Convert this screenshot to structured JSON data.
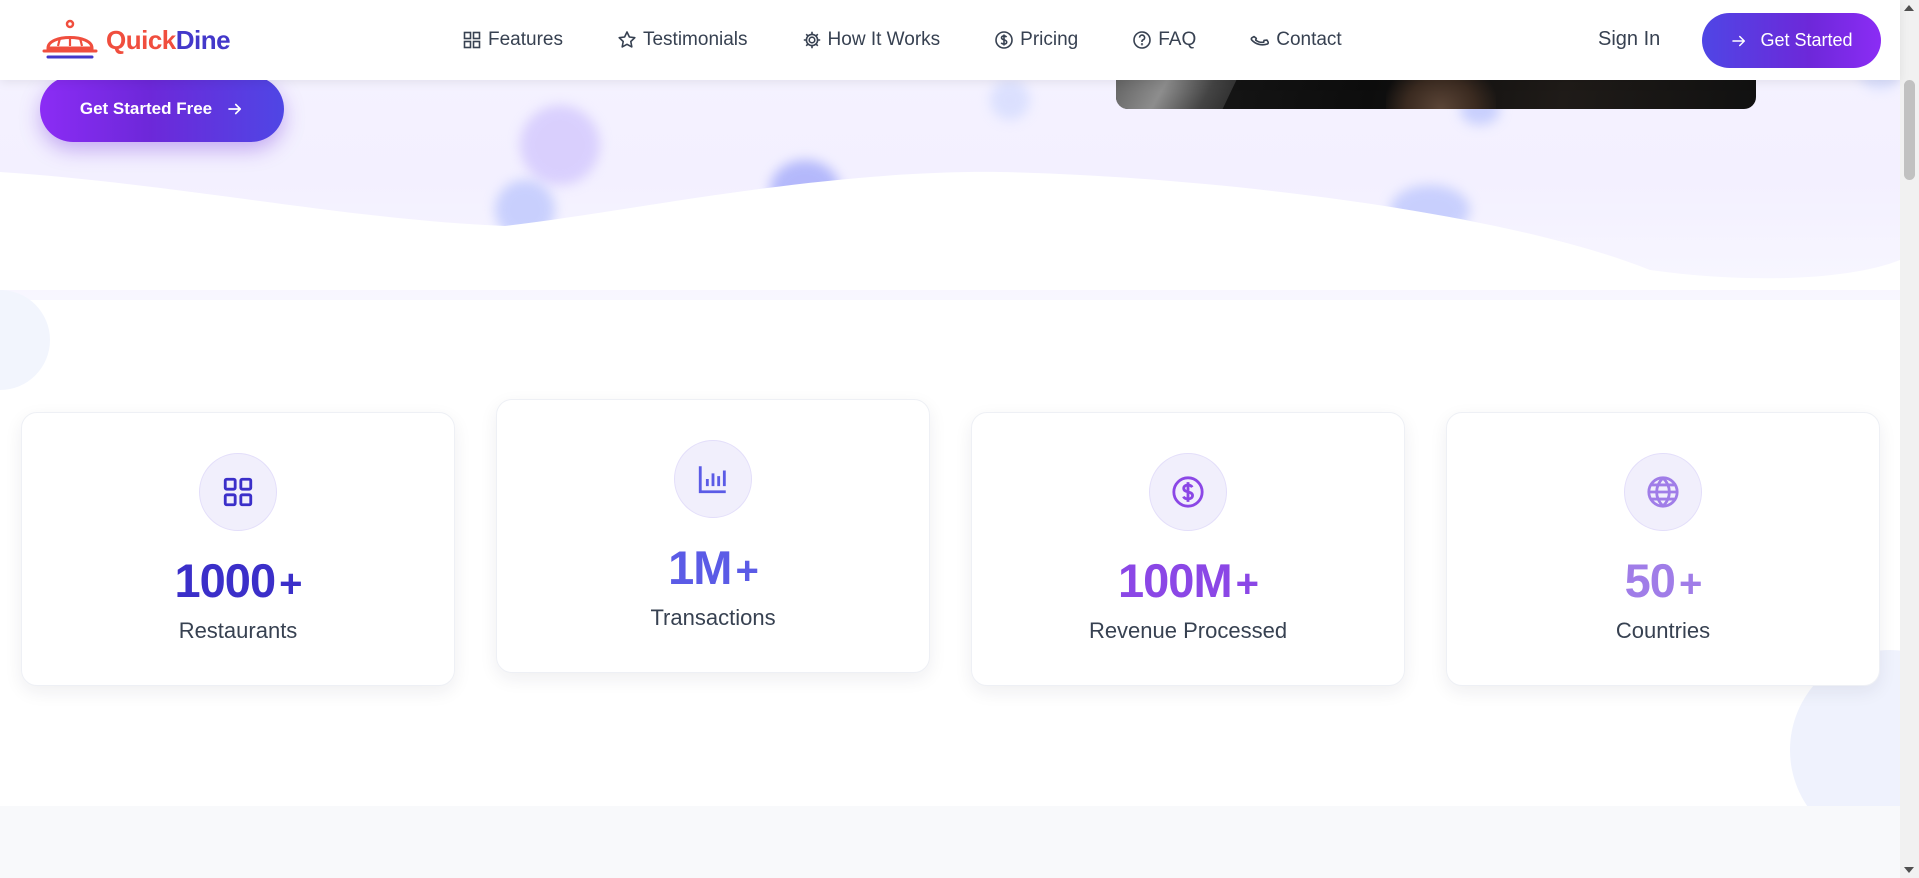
{
  "brand": {
    "name_part1": "Quick",
    "name_part2": "Dine",
    "colors": {
      "orange": "#f04e3e",
      "indigo": "#4338ca",
      "purple": "#7c3aed"
    }
  },
  "nav": {
    "links": [
      {
        "label": "Features",
        "icon": "grid-icon"
      },
      {
        "label": "Testimonials",
        "icon": "star-icon"
      },
      {
        "label": "How It Works",
        "icon": "gear-icon"
      },
      {
        "label": "Pricing",
        "icon": "dollar-circle-icon"
      },
      {
        "label": "FAQ",
        "icon": "question-circle-icon"
      },
      {
        "label": "Contact",
        "icon": "phone-icon"
      }
    ],
    "sign_in": "Sign In",
    "cta": "Get Started"
  },
  "hero": {
    "cta": "Get Started Free"
  },
  "stats": [
    {
      "value": "1000",
      "suffix": "+",
      "label": "Restaurants",
      "icon": "grid-icon",
      "color": "#3b2fc9"
    },
    {
      "value": "1M",
      "suffix": "+",
      "label": "Transactions",
      "icon": "bar-chart-icon",
      "color": "#5b5be6"
    },
    {
      "value": "100M",
      "suffix": "+",
      "label": "Revenue Processed",
      "icon": "dollar-circle-icon",
      "color": "#8b47e6"
    },
    {
      "value": "50",
      "suffix": "+",
      "label": "Countries",
      "icon": "globe-icon",
      "color": "#a07de8"
    }
  ]
}
